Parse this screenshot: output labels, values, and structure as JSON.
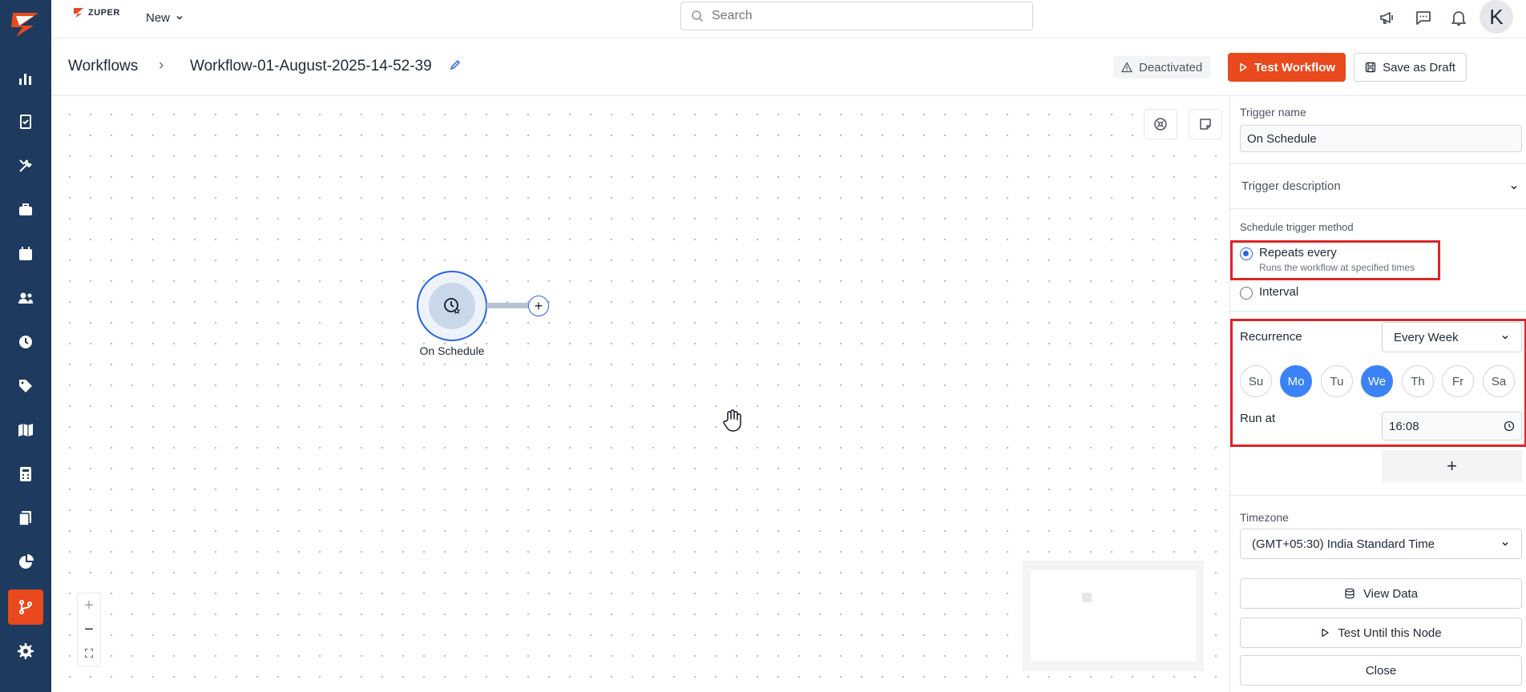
{
  "app": {
    "brand": "ZUPER"
  },
  "topbar": {
    "new_label": "New",
    "search_placeholder": "Search",
    "avatar_initial": "K"
  },
  "header": {
    "breadcrumb_root": "Workflows",
    "breadcrumb_sep": "›",
    "workflow_title": "Workflow-01-August-2025-14-52-39",
    "status_badge": "Deactivated",
    "test_button": "Test Workflow",
    "draft_button": "Save as Draft"
  },
  "canvas": {
    "node_label": "On Schedule",
    "zoom_in": "+",
    "zoom_out": "−",
    "fit": "⛶"
  },
  "panel": {
    "trigger_name_label": "Trigger name",
    "trigger_name_value": "On Schedule",
    "trigger_description_label": "Trigger description",
    "method_label": "Schedule trigger method",
    "method_repeats_label": "Repeats every",
    "method_repeats_help": "Runs the workflow at specified times",
    "method_interval_label": "Interval",
    "recurrence_label": "Recurrence",
    "recurrence_value": "Every Week",
    "days": [
      {
        "label": "Su",
        "selected": false
      },
      {
        "label": "Mo",
        "selected": true
      },
      {
        "label": "Tu",
        "selected": false
      },
      {
        "label": "We",
        "selected": true
      },
      {
        "label": "Th",
        "selected": false
      },
      {
        "label": "Fr",
        "selected": false
      },
      {
        "label": "Sa",
        "selected": false
      }
    ],
    "run_at_label": "Run at",
    "run_at_value": "16:08",
    "add_time_label": "+",
    "timezone_label": "Timezone",
    "timezone_value": "(GMT+05:30) India Standard Time",
    "view_data_button": "View Data",
    "test_until_button": "Test Until this Node",
    "close_button": "Close"
  },
  "colors": {
    "sidebar_bg": "#1e3a5f",
    "accent_orange": "#e8491d",
    "selected_blue": "#3b82f6",
    "highlight_red": "#dc2626"
  }
}
